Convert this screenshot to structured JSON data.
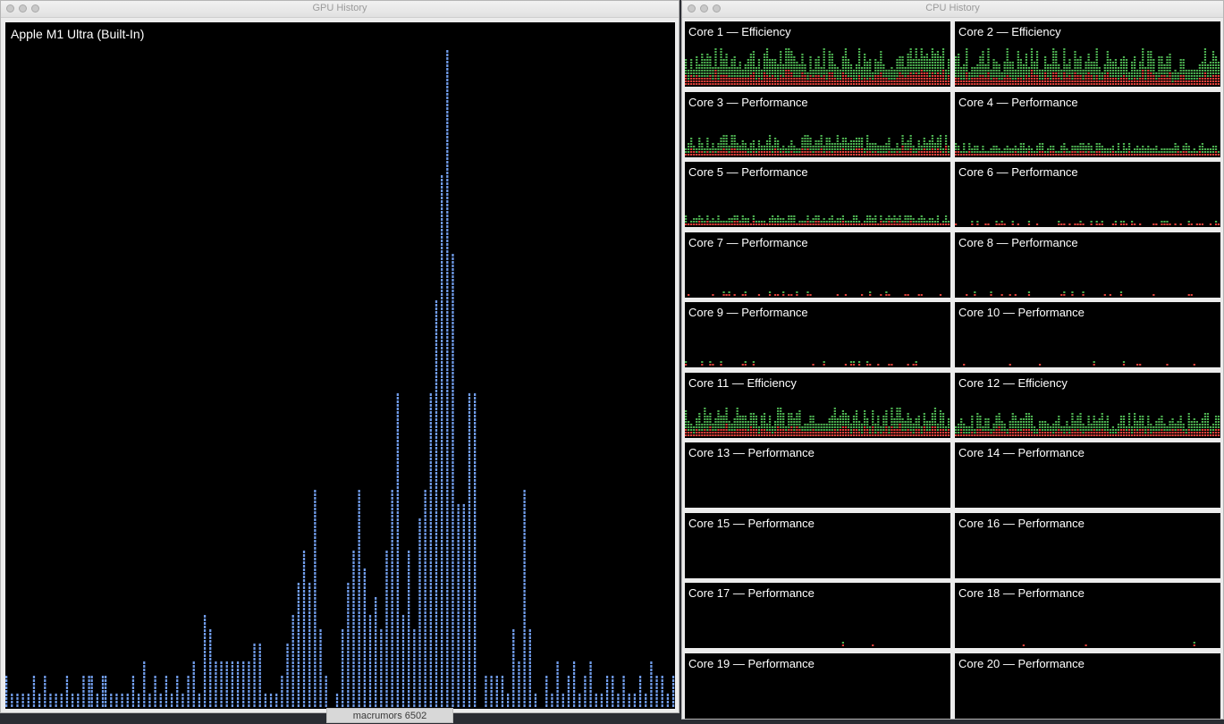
{
  "gpu_window": {
    "title": "GPU History",
    "gpu_name": "Apple M1 Ultra (Built-In)",
    "color": "#6f9be8",
    "history": [
      2,
      0,
      1,
      0,
      1,
      0,
      1,
      0,
      1,
      0,
      2,
      0,
      1,
      0,
      2,
      0,
      1,
      0,
      1,
      0,
      1,
      0,
      2,
      0,
      1,
      0,
      1,
      0,
      2,
      0,
      2,
      2,
      0,
      1,
      0,
      2,
      2,
      0,
      1,
      0,
      1,
      0,
      1,
      0,
      1,
      0,
      2,
      0,
      1,
      0,
      3,
      0,
      1,
      0,
      2,
      0,
      1,
      0,
      2,
      0,
      1,
      0,
      2,
      0,
      1,
      0,
      2,
      0,
      3,
      0,
      1,
      0,
      6,
      0,
      5,
      0,
      3,
      0,
      3,
      0,
      3,
      0,
      3,
      0,
      3,
      0,
      3,
      0,
      3,
      0,
      4,
      0,
      4,
      0,
      1,
      0,
      1,
      0,
      1,
      0,
      2,
      0,
      4,
      0,
      6,
      0,
      8,
      0,
      10,
      0,
      8,
      0,
      14,
      0,
      5,
      0,
      2,
      0,
      0,
      0,
      1,
      0,
      5,
      0,
      8,
      0,
      10,
      0,
      14,
      0,
      9,
      0,
      6,
      0,
      7,
      0,
      5,
      0,
      10,
      0,
      14,
      0,
      20,
      0,
      6,
      0,
      10,
      0,
      5,
      0,
      12,
      0,
      14,
      0,
      20,
      0,
      26,
      0,
      34,
      0,
      45,
      0,
      29,
      0,
      13,
      0,
      13,
      0,
      20,
      0,
      20,
      0,
      0,
      0,
      2,
      0,
      2,
      0,
      2,
      0,
      2,
      0,
      1,
      0,
      5,
      0,
      3,
      0,
      14,
      0,
      5,
      0,
      1,
      0,
      0,
      0,
      2,
      0,
      1,
      0,
      3,
      0,
      1,
      0,
      2,
      0,
      3,
      0,
      1,
      0,
      2,
      0,
      3,
      0,
      1,
      0,
      1,
      0,
      2,
      0,
      2,
      0,
      1,
      0,
      2,
      0,
      1,
      0,
      1,
      0,
      2,
      0,
      1,
      0,
      3,
      0,
      2,
      0,
      2,
      0,
      1,
      0,
      2
    ],
    "history_max": 40
  },
  "cpu_window": {
    "title": "CPU History",
    "colors": {
      "user": "#4caf50",
      "system": "#e0413a"
    },
    "cores": [
      {
        "label": "Core 1 — Efficiency",
        "level": 0.75
      },
      {
        "label": "Core 2 — Efficiency",
        "level": 0.7
      },
      {
        "label": "Core 3 — Performance",
        "level": 0.4
      },
      {
        "label": "Core 4 — Performance",
        "level": 0.25
      },
      {
        "label": "Core 5 — Performance",
        "level": 0.2
      },
      {
        "label": "Core 6 — Performance",
        "level": 0.15
      },
      {
        "label": "Core 7 — Performance",
        "level": 0.1
      },
      {
        "label": "Core 8 — Performance",
        "level": 0.05
      },
      {
        "label": "Core 9 — Performance",
        "level": 0.05
      },
      {
        "label": "Core 10 — Performance",
        "level": 0.03
      },
      {
        "label": "Core 11 — Efficiency",
        "level": 0.55
      },
      {
        "label": "Core 12 — Efficiency",
        "level": 0.45
      },
      {
        "label": "Core 13 — Performance",
        "level": 0
      },
      {
        "label": "Core 14 — Performance",
        "level": 0
      },
      {
        "label": "Core 15 — Performance",
        "level": 0
      },
      {
        "label": "Core 16 — Performance",
        "level": 0
      },
      {
        "label": "Core 17 — Performance",
        "level": 0.01
      },
      {
        "label": "Core 18 — Performance",
        "level": 0.01
      },
      {
        "label": "Core 19 — Performance",
        "level": 0
      },
      {
        "label": "Core 20 — Performance",
        "level": 0
      }
    ]
  },
  "background_tab": {
    "label": "macrumors 6502"
  }
}
